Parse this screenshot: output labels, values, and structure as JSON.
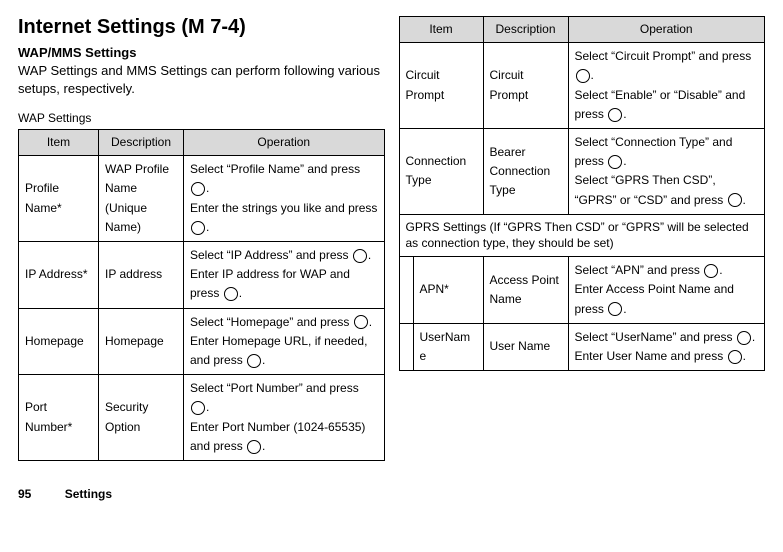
{
  "header": {
    "title": "Internet Settings",
    "menu_location": "(M 7-4)",
    "subtitle": "WAP/MMS Settings",
    "intro": "WAP Settings and MMS Settings can perform following various setups, respectively.",
    "subhead": "WAP Settings"
  },
  "footer": {
    "page_number": "95",
    "section": "Settings"
  },
  "table_headers": {
    "item": "Item",
    "description": "Description",
    "operation": "Operation"
  },
  "left_rows": [
    {
      "item": "Profile Name*",
      "desc": "WAP Profile Name (Unique Name)",
      "op_a": "Select “Profile Name” and press ",
      "op_b": ".\nEnter the strings you like and press ",
      "op_c": "."
    },
    {
      "item": "IP Address*",
      "desc": "IP address",
      "op_a": "Select “IP Address” and press ",
      "op_b": ".\nEnter IP address for WAP and press ",
      "op_c": "."
    },
    {
      "item": "Homepage",
      "desc": "Homepage",
      "op_a": "Select “Homepage” and press ",
      "op_b": ".\nEnter Homepage URL, if needed, and press ",
      "op_c": "."
    },
    {
      "item": "Port Number*",
      "desc": "Security Option",
      "op_a": "Select “Port Number” and press ",
      "op_b": ".\nEnter Port Number (1024-65535) and press ",
      "op_c": "."
    }
  ],
  "right_rows_top": [
    {
      "item": "Circuit Prompt",
      "desc": "Circuit Prompt",
      "op_a": "Select “Circuit Prompt” and press ",
      "op_b": ".\nSelect “Enable” or “Disable” and press ",
      "op_c": "."
    },
    {
      "item": "Connection Type",
      "desc": "Bearer Connection Type",
      "op_a": "Select “Connection Type” and press ",
      "op_b": ".\nSelect “GPRS Then CSD”, “GPRS” or “CSD” and press ",
      "op_c": "."
    }
  ],
  "right_note": "GPRS Settings (If “GPRS Then CSD” or “GPRS” will be selected as connection type, they should be set)",
  "right_rows_sub": [
    {
      "item": "APN*",
      "desc": "Access Point Name",
      "op_a": "Select “APN” and press ",
      "op_b": ".\nEnter Access Point Name and press ",
      "op_c": "."
    },
    {
      "item": "UserName",
      "desc": "User Name",
      "op_a": "Select “UserName” and press ",
      "op_b": ".\nEnter User Name and press ",
      "op_c": "."
    }
  ]
}
